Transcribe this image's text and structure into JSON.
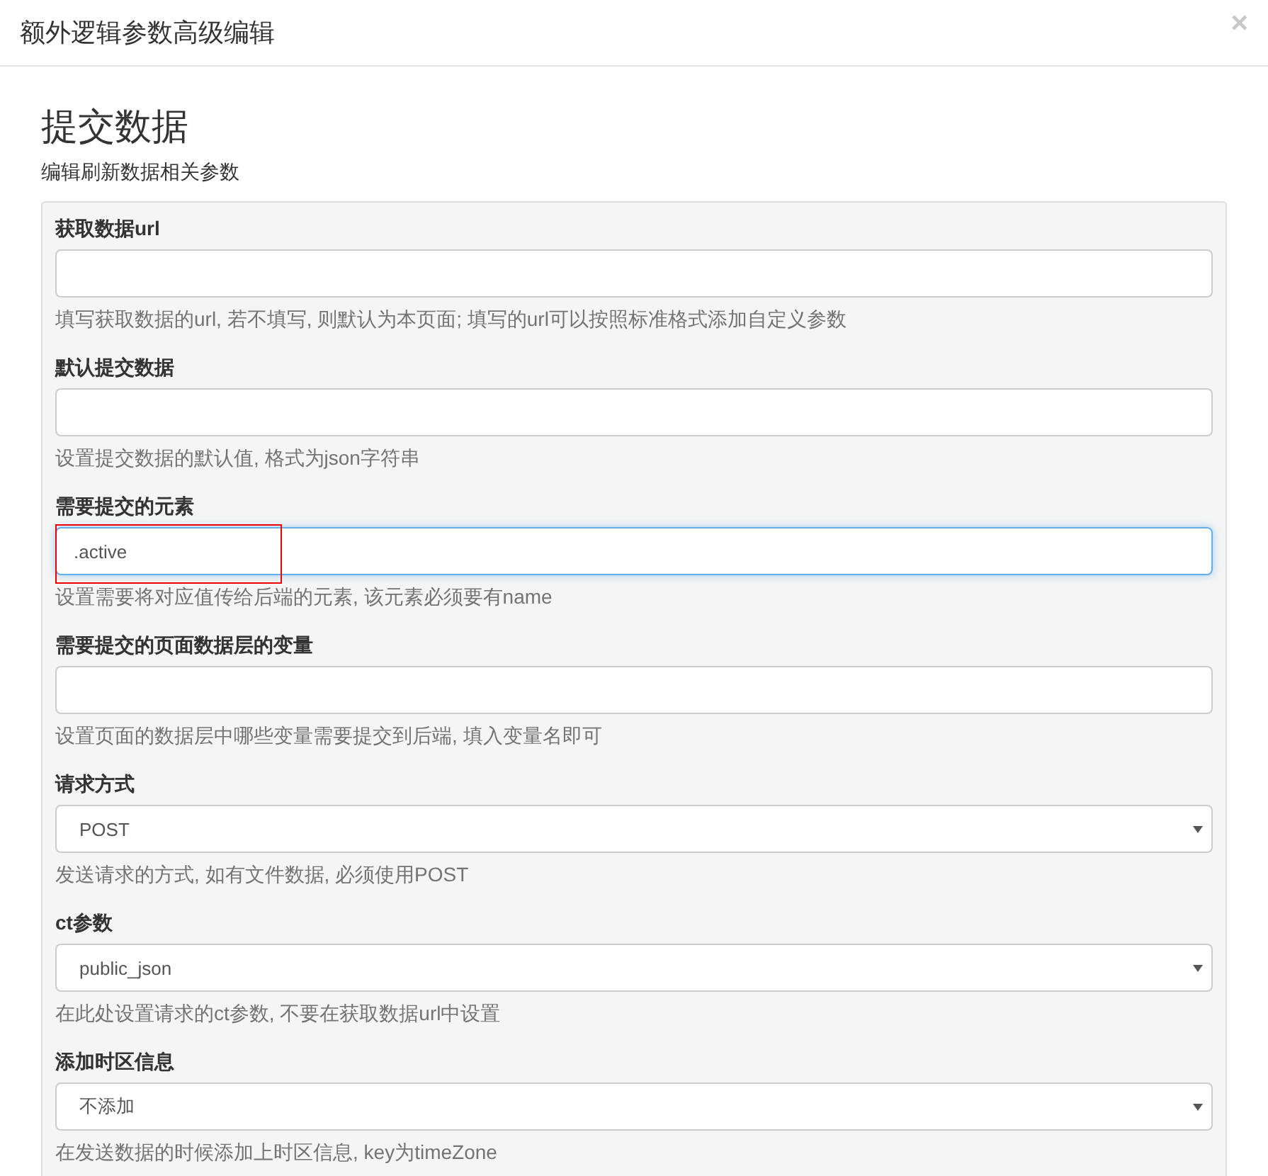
{
  "dialog": {
    "title": "额外逻辑参数高级编辑",
    "close": "×"
  },
  "section": {
    "heading": "提交数据",
    "subtitle": "编辑刷新数据相关参数"
  },
  "fields": [
    {
      "kind": "text",
      "label": "获取数据url",
      "focused": false,
      "highlighted": false,
      "help": "填写获取数据的url, 若不填写, 则默认为本页面; 填写的url可以按照标准格式添加自定义参数"
    },
    {
      "kind": "text",
      "label": "默认提交数据",
      "focused": false,
      "highlighted": false,
      "help": "设置提交数据的默认值, 格式为json字符串"
    },
    {
      "kind": "text",
      "label": "需要提交的元素",
      "value": ".active",
      "focused": true,
      "highlighted": true,
      "help": "设置需要将对应值传给后端的元素, 该元素必须要有name"
    },
    {
      "kind": "text",
      "label": "需要提交的页面数据层的变量",
      "focused": false,
      "highlighted": false,
      "help": "设置页面的数据层中哪些变量需要提交到后端, 填入变量名即可"
    },
    {
      "kind": "select",
      "label": "请求方式",
      "value": "POST",
      "focused": false,
      "highlighted": false,
      "help": "发送请求的方式, 如有文件数据, 必须使用POST"
    },
    {
      "kind": "select",
      "label": "ct参数",
      "value": "public_json",
      "focused": false,
      "highlighted": false,
      "help": "在此处设置请求的ct参数, 不要在获取数据url中设置"
    },
    {
      "kind": "select",
      "label": "添加时区信息",
      "value": "不添加",
      "focused": false,
      "highlighted": false,
      "help": "在发送数据的时候添加上时区信息, key为timeZone"
    }
  ]
}
